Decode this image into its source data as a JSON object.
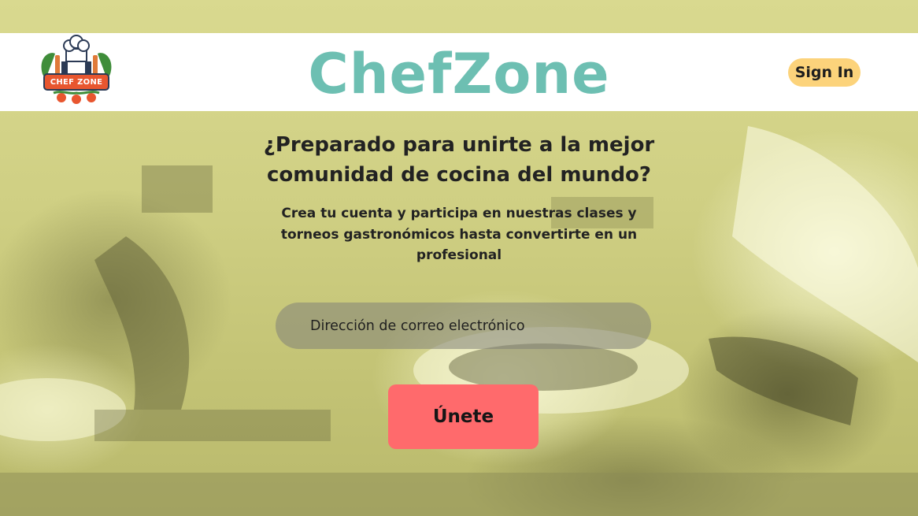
{
  "app": {
    "brand": "ChefZone",
    "logo_text": "CHEF ZONE"
  },
  "header": {
    "signin_label": "Sign In"
  },
  "hero": {
    "headline": "¿Preparado para unirte a la mejor comunidad de cocina del mundo?",
    "subtext": "Crea tu cuenta y participa en nuestras clases y torneos gastronómicos hasta convertirte en un profesional"
  },
  "form": {
    "email_placeholder": "Dirección de correo electrónico",
    "email_value": "",
    "join_label": "Únete"
  },
  "colors": {
    "brand_teal": "#6dbfb2",
    "signin_yellow": "#fcd37b",
    "join_red": "#ff6a6c",
    "background_tint": "#cfcf86"
  },
  "icons": {
    "logo": "chef-hat-logo-icon"
  }
}
